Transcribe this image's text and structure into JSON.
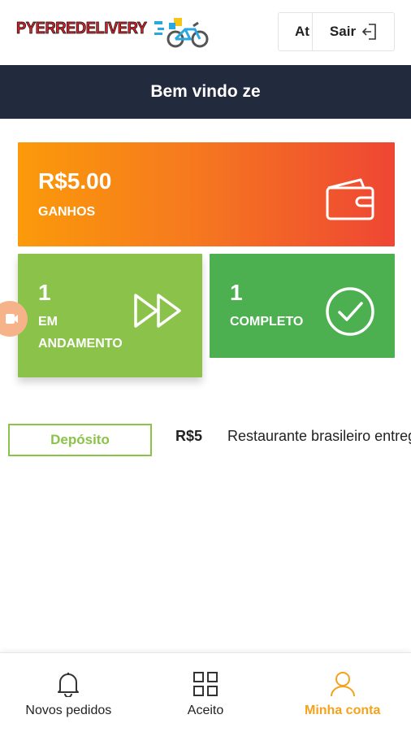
{
  "header": {
    "logo_left": "PYERRE",
    "logo_right": "DELIVERY",
    "btn_at": "At",
    "btn_sair": "Sair"
  },
  "welcome": "Bem vindo ze",
  "cards": {
    "earnings": {
      "value": "R$5.00",
      "label": "GANHOS",
      "icon": "wallet-icon"
    },
    "in_progress": {
      "value": "1",
      "label_line1": "EM",
      "label_line2": "ANDAMENTO",
      "icon": "fast-forward-icon"
    },
    "completed": {
      "value": "1",
      "label": "COMPLETO",
      "icon": "check-circle-icon"
    }
  },
  "transaction": {
    "type": "Depósito",
    "amount": "R$5",
    "description": "Restaurante brasileiro entrega"
  },
  "bottom_nav": [
    {
      "label": "Novos pedidos",
      "icon": "bell-icon",
      "active": false
    },
    {
      "label": "Aceito",
      "icon": "grid-icon",
      "active": false
    },
    {
      "label": "Minha conta",
      "icon": "user-icon",
      "active": true
    }
  ],
  "colors": {
    "header_bar": "#222a3e",
    "earnings_start": "#fb9a0a",
    "earnings_end": "#ee4634",
    "progress": "#8bc34a",
    "completed": "#4caf50",
    "accent": "#f5a21b"
  }
}
